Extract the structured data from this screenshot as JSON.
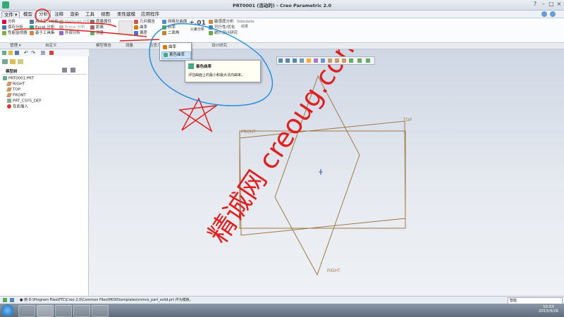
{
  "window": {
    "title": "PRT0001 (活动的) - Creo Parametric 2.0"
  },
  "menus": [
    {
      "label": "文件 ▾"
    },
    {
      "label": "模型"
    },
    {
      "label": "分析"
    },
    {
      "label": "注释"
    },
    {
      "label": "渲染"
    },
    {
      "label": "工具"
    },
    {
      "label": "视图"
    },
    {
      "label": "柔性建模"
    },
    {
      "label": "应用程序"
    }
  ],
  "ribbon": {
    "col1": [
      "分析",
      "保存分析",
      "性能监视器"
    ],
    "col2": [
      "用户定义分析",
      "Excel 分析",
      "基于工具集"
    ],
    "col3": [
      "Mathcad 分析",
      "Prime 分析",
      "外部分析"
    ],
    "col4": [
      "质量属性",
      "距离",
      "测量"
    ],
    "col5": [
      "几何报告",
      "曲率",
      "偏差"
    ],
    "col6": [
      "网格化曲面",
      "斜率",
      "二面角"
    ],
    "col7": [
      "灵敏度分析",
      "可行性/优化",
      "设计设计研究"
    ],
    "col8": [
      "敏感度分析",
      "统计设计研究"
    ],
    "simulate": "Simulate",
    "sim_sub": "结果",
    "model_sel": "公差分析"
  },
  "groups": [
    "管理 ▾",
    "自定义",
    "模型报告",
    "测量",
    "检查几何 ▾",
    "设计研究"
  ],
  "dropdown": {
    "items": [
      "曲率",
      "着色曲率"
    ]
  },
  "tooltip": {
    "title": "着色曲率",
    "body": "评估曲面上的最小和最大法向曲率。"
  },
  "navpane": {
    "label": "模型树",
    "items": [
      "PRT0001.PRT",
      "RIGHT",
      "TOP",
      "FRONT",
      "PRT_CSYS_DEF",
      "在此插入"
    ]
  },
  "graphics": {
    "plane_labels": [
      "FRONT",
      "TOP",
      "RIGHT"
    ],
    "watermark": "精诚网 creoug.com"
  },
  "statusbar": {
    "text": "● 用 D:\\Program Files\\PTC\\Creo 2.0\\Common Files\\M030\\templates\\mmns_part_solid.prt 作为模板。",
    "selection": "智能"
  },
  "taskbar": {
    "time": "10:03",
    "date": "2015/4/26"
  },
  "colors": {
    "annotation_red": "#e02020",
    "annotation_blue": "#2a8fd8",
    "plane": "#a07845"
  }
}
